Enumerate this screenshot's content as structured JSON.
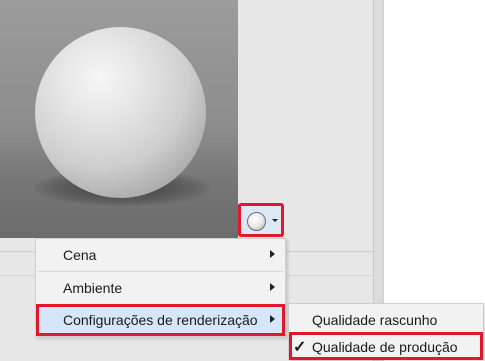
{
  "material_button": {
    "icon": "sphere-preview-icon",
    "dropdown_icon": "chevron-down-icon"
  },
  "menu": {
    "items": [
      {
        "label": "Cena",
        "has_submenu": true
      },
      {
        "label": "Ambiente",
        "has_submenu": true
      },
      {
        "label": "Configurações de renderização",
        "has_submenu": true,
        "highlighted": true
      }
    ]
  },
  "submenu": {
    "items": [
      {
        "label": "Qualidade rascunho",
        "checked": false
      },
      {
        "label": "Qualidade de produção",
        "checked": true,
        "check_mark": "✓"
      }
    ]
  },
  "colors": {
    "highlight_border": "#e0182e",
    "menu_hover": "#d4e6f8"
  }
}
